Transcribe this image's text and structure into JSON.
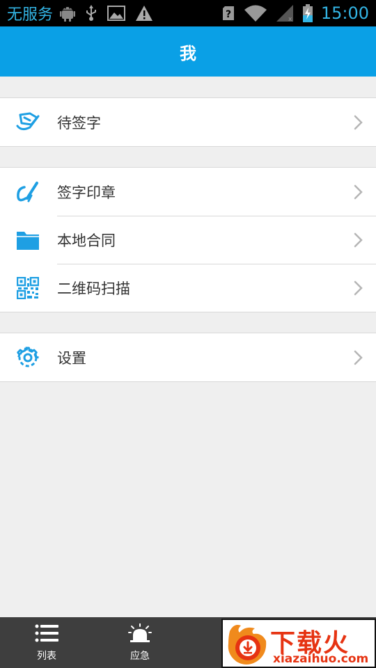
{
  "status_bar": {
    "carrier": "无服务",
    "time": "15:00",
    "left_icons": [
      "android-debug-icon",
      "usb-icon",
      "image-icon",
      "warning-icon"
    ],
    "right_icons": [
      "sim-unknown-icon",
      "wifi-icon",
      "signal-icon",
      "battery-charging-icon"
    ]
  },
  "header": {
    "title": "我"
  },
  "menu": {
    "groups": [
      {
        "items": [
          {
            "label": "待签字",
            "icon": "sign-pending-icon"
          }
        ]
      },
      {
        "items": [
          {
            "label": "签字印章",
            "icon": "signature-pen-icon"
          },
          {
            "label": "本地合同",
            "icon": "folder-icon"
          },
          {
            "label": "二维码扫描",
            "icon": "qr-code-icon"
          }
        ]
      },
      {
        "items": [
          {
            "label": "设置",
            "icon": "gear-icon"
          }
        ]
      }
    ]
  },
  "tabbar": {
    "tabs": [
      {
        "label": "列表",
        "icon": "list-icon"
      },
      {
        "label": "应急",
        "icon": "alarm-light-icon"
      }
    ]
  },
  "ad": {
    "title": "下载火",
    "url": "xiazaihuo.com",
    "icon": "flame-logo-icon"
  },
  "colors": {
    "accent": "#0aa0e6",
    "icon_blue": "#1e9fe3",
    "background": "#efefef",
    "tabbar": "#3e3e3e",
    "ad_red": "#e63312"
  }
}
